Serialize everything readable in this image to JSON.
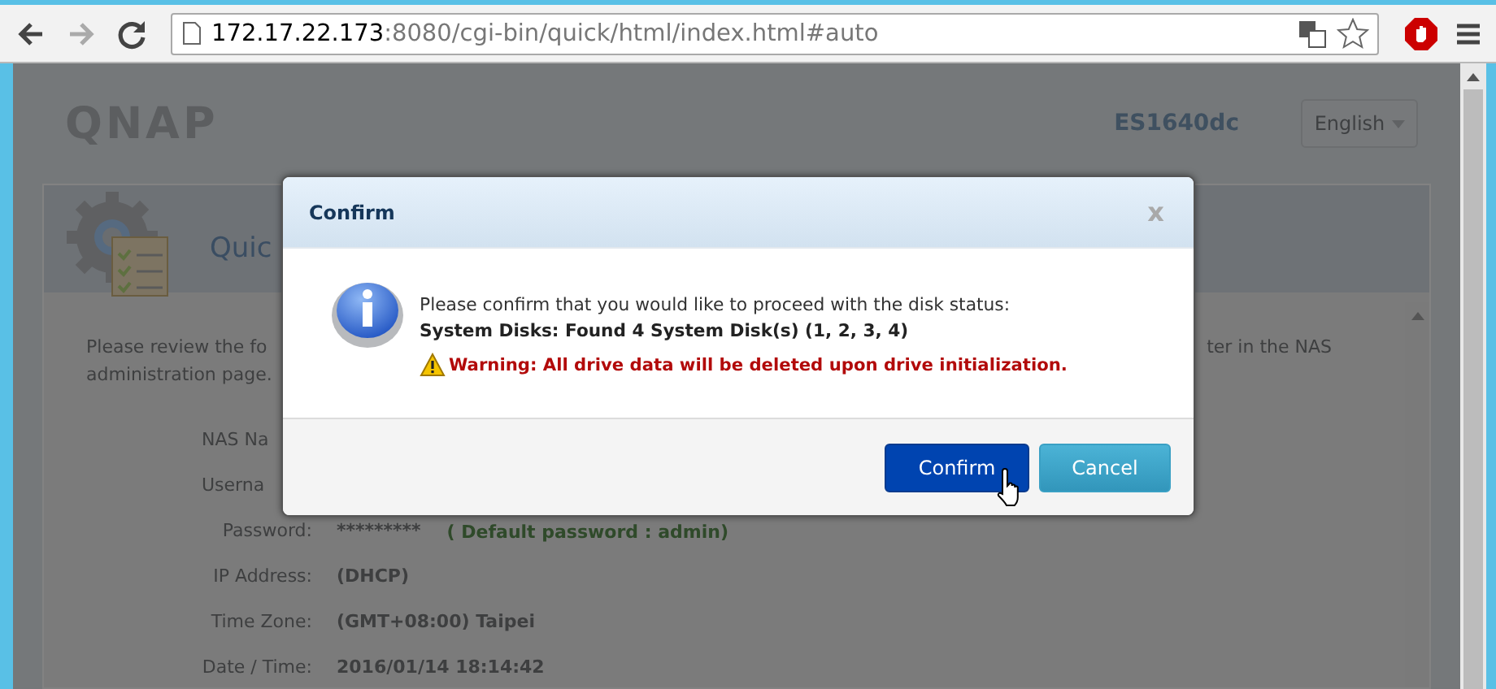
{
  "browser": {
    "url": {
      "host": "172.17.22.173",
      "path": ":8080/cgi-bin/quick/html/index.html#auto"
    }
  },
  "page": {
    "logo": "QNAP",
    "model": "ES1640dc",
    "language": "English",
    "title": "Quic",
    "intro": {
      "start": "Please review the fo",
      "end": "ter in the NAS",
      "line2": "administration page."
    },
    "rows": [
      {
        "label": "NAS Na"
      },
      {
        "label": "Userna"
      },
      {
        "label": "Password:",
        "value": "*********",
        "note": "( Default password : admin)"
      },
      {
        "label": "IP Address:",
        "value": "(DHCP)"
      },
      {
        "label": "Time Zone:",
        "value": "(GMT+08:00) Taipei"
      },
      {
        "label": "Date / Time:",
        "value": "2016/01/14 18:14:42"
      }
    ]
  },
  "dialog": {
    "title": "Confirm",
    "close": "x",
    "message": "Please confirm that you would like to proceed with the disk status:",
    "detail": "System Disks: Found 4 System Disk(s) (1, 2, 3, 4)",
    "warning": "Warning: All drive data will be deleted upon drive initialization.",
    "buttons": [
      {
        "label": "Confirm",
        "kind": "primary",
        "hovered": true
      },
      {
        "label": "Cancel",
        "kind": "secondary",
        "hovered": false
      }
    ]
  }
}
